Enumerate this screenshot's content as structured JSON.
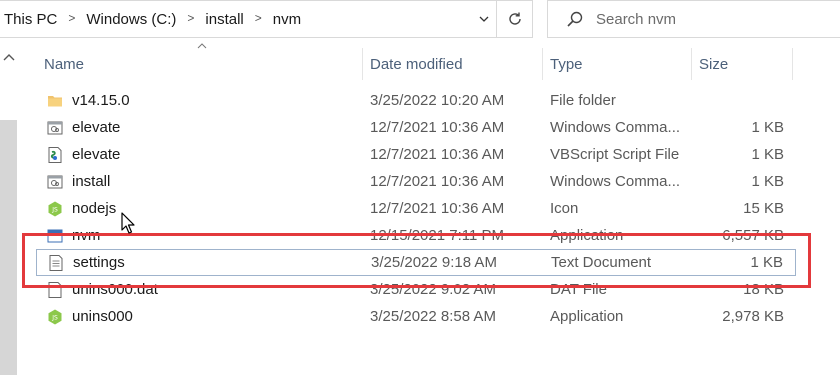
{
  "address_bar": {
    "breadcrumbs": [
      "This PC",
      "Windows (C:)",
      "install",
      "nvm"
    ],
    "separator": ">"
  },
  "search": {
    "placeholder": "Search nvm",
    "icon": "search-icon"
  },
  "columns": {
    "name": "Name",
    "date_modified": "Date modified",
    "type": "Type",
    "size": "Size"
  },
  "files": [
    {
      "name": "v14.15.0",
      "date": "3/25/2022 10:20 AM",
      "type": "File folder",
      "size": "",
      "icon": "folder-icon"
    },
    {
      "name": "elevate",
      "date": "12/7/2021 10:36 AM",
      "type": "Windows Comma...",
      "size": "1 KB",
      "icon": "cmd-file-icon"
    },
    {
      "name": "elevate",
      "date": "12/7/2021 10:36 AM",
      "type": "VBScript Script File",
      "size": "1 KB",
      "icon": "vbscript-icon"
    },
    {
      "name": "install",
      "date": "12/7/2021 10:36 AM",
      "type": "Windows Comma...",
      "size": "1 KB",
      "icon": "cmd-file-icon"
    },
    {
      "name": "nodejs",
      "date": "12/7/2021 10:36 AM",
      "type": "Icon",
      "size": "15 KB",
      "icon": "nodejs-icon"
    },
    {
      "name": "nvm",
      "date": "12/15/2021 7:11 PM",
      "type": "Application",
      "size": "6,557 KB",
      "icon": "application-icon"
    },
    {
      "name": "settings",
      "date": "3/25/2022 9:18 AM",
      "type": "Text Document",
      "size": "1 KB",
      "icon": "text-document-icon"
    },
    {
      "name": "unins000.dat",
      "date": "3/25/2022 9:02 AM",
      "type": "DAT File",
      "size": "18 KB",
      "icon": "blank-file-icon"
    },
    {
      "name": "unins000",
      "date": "3/25/2022 8:58 AM",
      "type": "Application",
      "size": "2,978 KB",
      "icon": "nodejs-icon"
    }
  ],
  "colors": {
    "highlight": "#e3393c",
    "header_text": "#4c607a",
    "selection_border": "#9fb3cc",
    "folder": "#f0c36d"
  }
}
